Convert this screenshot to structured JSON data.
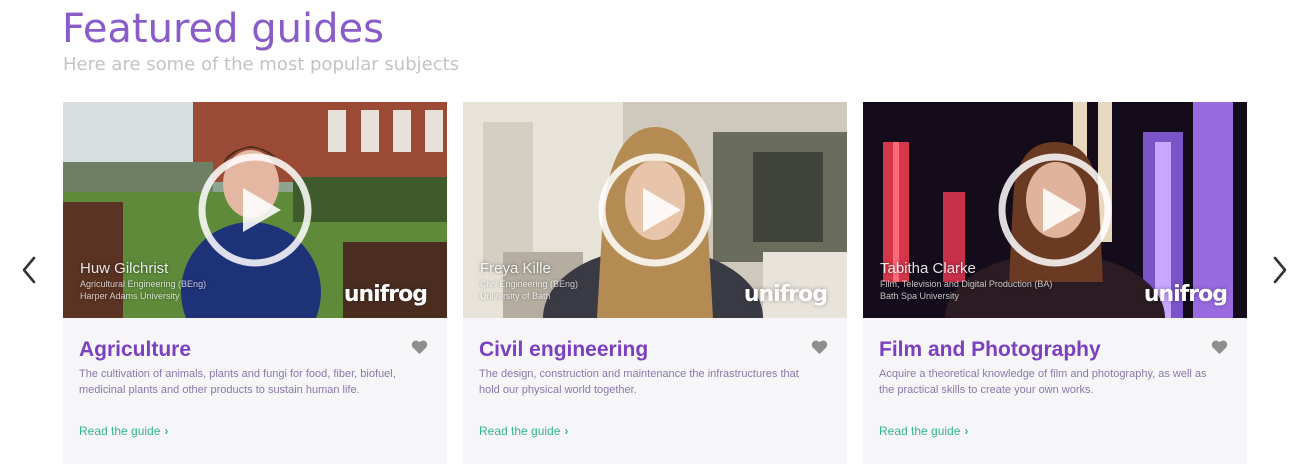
{
  "header": {
    "title": "Featured guides",
    "subtitle": "Here are some of the most popular subjects"
  },
  "colors": {
    "title": "#8a5cc7",
    "subtitle": "#c2c2c8",
    "card_title": "#7b3fbf",
    "link": "#35b58c",
    "card_bg": "#f6f5f8"
  },
  "carousel": {
    "prev_icon": "chevron-left-icon",
    "next_icon": "chevron-right-icon"
  },
  "cards": [
    {
      "title": "Agriculture",
      "description": "The cultivation of animals, plants and fungi for food, fiber, biofuel, medicinal plants and other products to sustain human life.",
      "link": "Read the guide",
      "video": {
        "name": "Huw Gilchrist",
        "course": "Agricultural Engineering (BEng)",
        "institution": "Harper Adams University",
        "brand": "unifrog"
      }
    },
    {
      "title": "Civil engineering",
      "description": "The design, construction and maintenance the infrastructures that hold our physical world together.",
      "link": "Read the guide",
      "video": {
        "name": "Freya Kille",
        "course": "Civil Engineering (BEng)",
        "institution": "University of Bath",
        "brand": "unifrog"
      }
    },
    {
      "title": "Film and Photography",
      "description": "Acquire a theoretical knowledge of film and photography, as well as the practical skills to create your own works.",
      "link": "Read the guide",
      "video": {
        "name": "Tabitha Clarke",
        "course": "Film, Television and Digital Production (BA)",
        "institution": "Bath Spa University",
        "brand": "unifrog"
      }
    }
  ]
}
